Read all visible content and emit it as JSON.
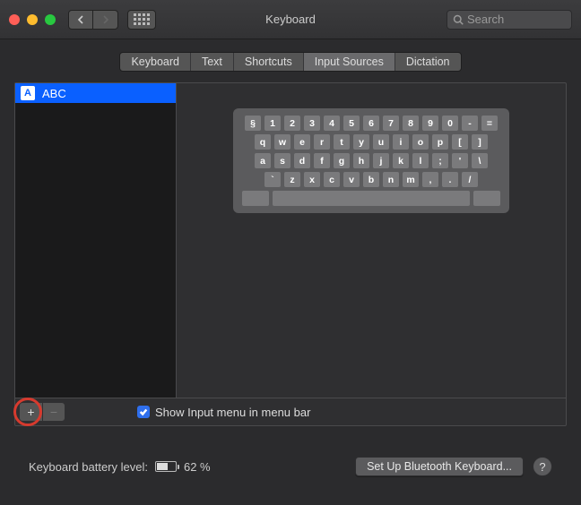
{
  "window": {
    "title": "Keyboard"
  },
  "search": {
    "placeholder": "Search"
  },
  "tabs": [
    "Keyboard",
    "Text",
    "Shortcuts",
    "Input Sources",
    "Dictation"
  ],
  "active_tab_index": 3,
  "sources": [
    {
      "icon_letter": "A",
      "label": "ABC",
      "selected": true
    }
  ],
  "keyboard_rows": [
    [
      "§",
      "1",
      "2",
      "3",
      "4",
      "5",
      "6",
      "7",
      "8",
      "9",
      "0",
      "-",
      "="
    ],
    [
      "q",
      "w",
      "e",
      "r",
      "t",
      "y",
      "u",
      "i",
      "o",
      "p",
      "[",
      "]"
    ],
    [
      "a",
      "s",
      "d",
      "f",
      "g",
      "h",
      "j",
      "k",
      "l",
      ";",
      "'",
      "\\"
    ],
    [
      "`",
      "z",
      "x",
      "c",
      "v",
      "b",
      "n",
      "m",
      ",",
      ".",
      "/"
    ]
  ],
  "buttons": {
    "add": "+",
    "remove": "−",
    "bluetooth": "Set Up Bluetooth Keyboard...",
    "help": "?"
  },
  "checkbox": {
    "label": "Show Input menu in menu bar",
    "checked": true
  },
  "battery": {
    "label": "Keyboard battery level:",
    "percent_text": "62 %"
  },
  "highlight_add_button": true
}
